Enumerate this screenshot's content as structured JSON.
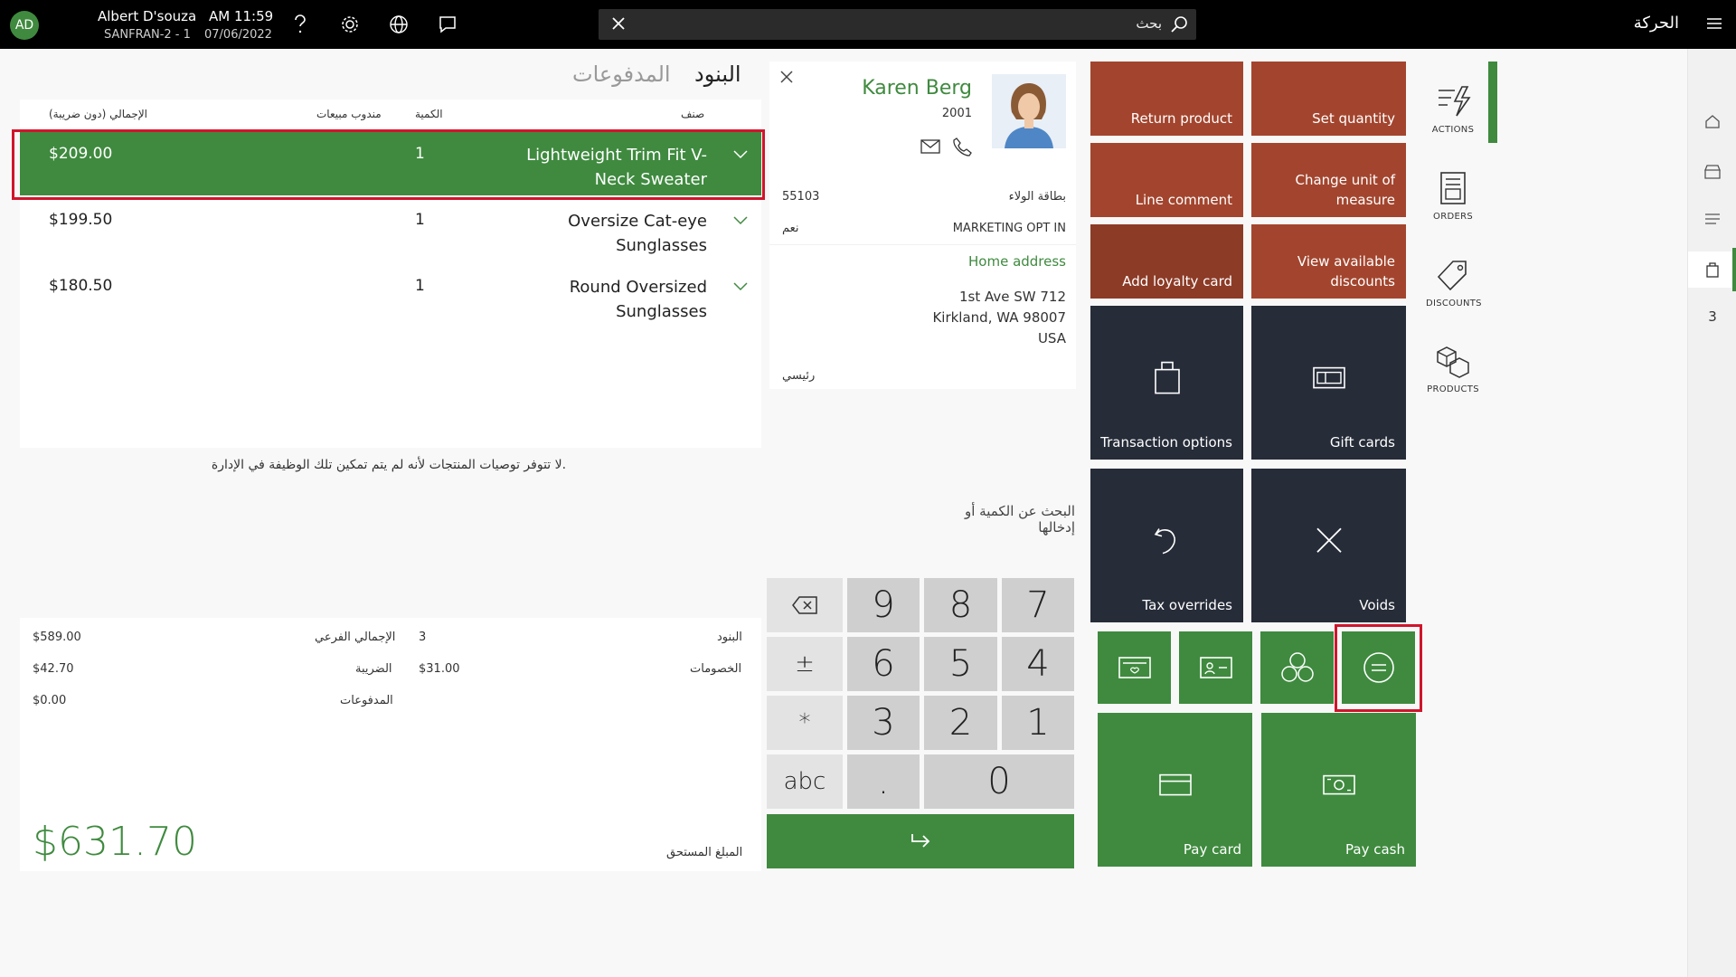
{
  "topbar": {
    "avatar_initials": "AD",
    "user_name": "Albert D'souza",
    "store": "SANFRAN-2 - 1",
    "time": "AM 11:59",
    "date": "07/06/2022",
    "search_placeholder": "بحث",
    "title": "الحركة",
    "icons": [
      "help-icon",
      "settings-icon",
      "globe-icon",
      "chat-icon",
      "close-icon",
      "search-icon",
      "hamburger-icon"
    ]
  },
  "rail": {
    "icons": [
      "home-icon",
      "store-icon",
      "lines-icon",
      "bag-icon"
    ],
    "count": "3"
  },
  "tabs": {
    "items": "البنود",
    "payments": "المدفوعات"
  },
  "lines": {
    "headers": {
      "product": "صنف",
      "qty": "الكمية",
      "rep": "مندوب مبيعات",
      "total": "الإجمالي (دون ضريبة)"
    },
    "rows": [
      {
        "name": "Lightweight Trim Fit V-Neck Sweater",
        "qty": "1",
        "amount": "$209.00",
        "selected": true
      },
      {
        "name": "Oversize Cat-eye Sunglasses",
        "qty": "1",
        "amount": "$199.50",
        "selected": false
      },
      {
        "name": "Round Oversized Sunglasses",
        "qty": "1",
        "amount": "$180.50",
        "selected": false
      }
    ]
  },
  "recommendations_msg": "لا تتوفر توصيات المنتجات لأنه لم يتم تمكين تلك الوظيفة في الإدارة.",
  "totals": {
    "lines_label": "البنود",
    "lines_value": "3",
    "discounts_label": "الخصومات",
    "discounts_value": "$31.00",
    "subtotal_label": "الإجمالي الفرعي",
    "subtotal_value": "$589.00",
    "tax_label": "الضريبة",
    "tax_value": "$42.70",
    "payments_label": "المدفوعات",
    "payments_value": "$0.00",
    "amount_due_label": "المبلغ المستحق",
    "amount_due": "$631.70"
  },
  "customer": {
    "name": "Karen Berg",
    "id": "2001",
    "loyalty_label": "بطاقة الولاء",
    "loyalty_value": "55103",
    "marketing_label": "MARKETING OPT IN",
    "marketing_value": "نعم",
    "address_head": "Home address",
    "address_line1": "1st Ave SW 712",
    "address_line2": "Kirkland, WA 98007",
    "address_line3": "USA",
    "primary_label": "رئيسي"
  },
  "numpad": {
    "search_hint": "البحث عن الكمية أو إدخالها",
    "keys": [
      "7",
      "8",
      "9",
      "4",
      "5",
      "6",
      "1",
      "2",
      "3",
      "0",
      "."
    ],
    "side": [
      "backspace",
      "±",
      "*",
      "abc"
    ]
  },
  "actions": {
    "return_product": "Return product",
    "set_quantity": "Set quantity",
    "line_comment": "Line comment",
    "change_unit": "Change unit of measure",
    "add_loyalty": "Add loyalty card",
    "view_discounts": "View available discounts",
    "transaction_options": "Transaction options",
    "gift_cards": "Gift cards",
    "tax_overrides": "Tax overrides",
    "voids": "Voids",
    "pay_card": "Pay card",
    "pay_cash": "Pay cash"
  },
  "side_tabs": {
    "actions": "ACTIONS",
    "orders": "ORDERS",
    "discounts": "DISCOUNTS",
    "products": "PRODUCTS"
  },
  "colors": {
    "green": "#3f8a3f",
    "brown": "#a3452e",
    "navy": "#262c38",
    "highlight": "#d0152b"
  }
}
